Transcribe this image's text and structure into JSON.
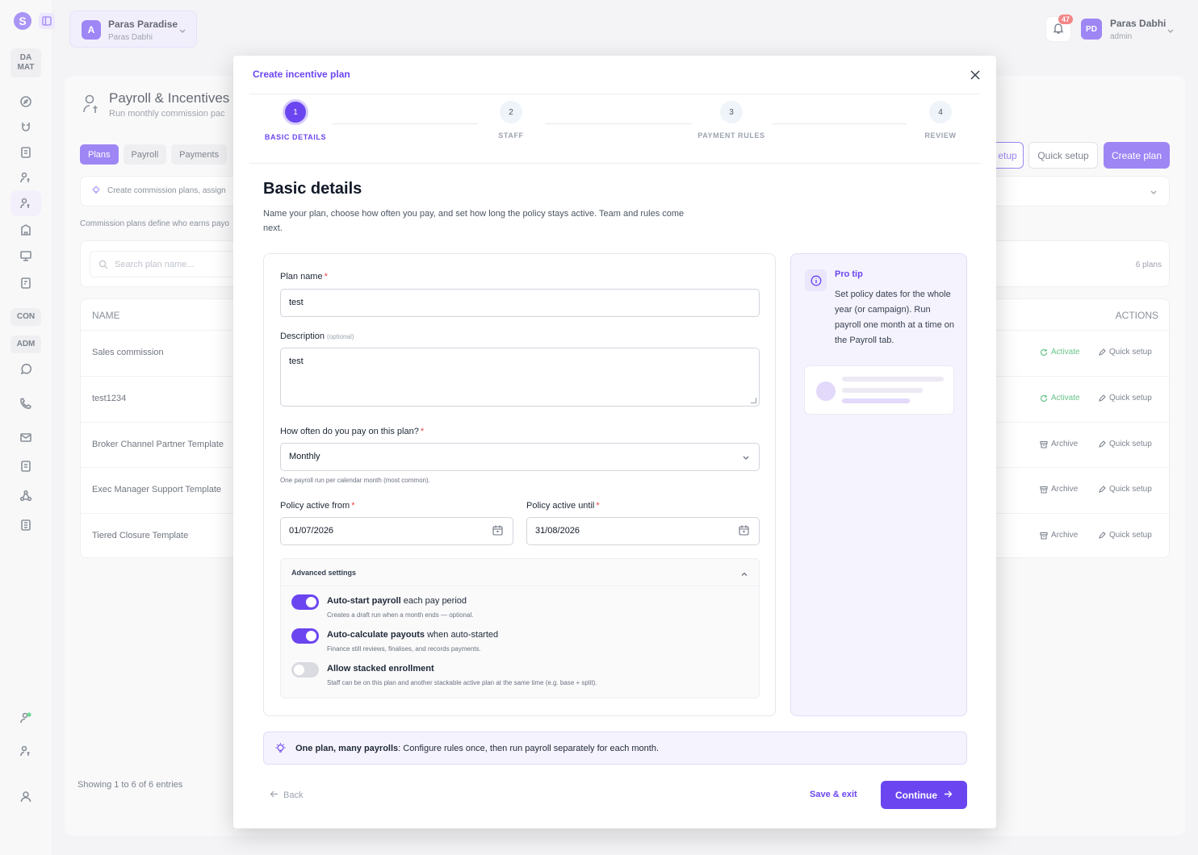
{
  "app": {
    "logo_letter": "S",
    "sidebar_tags": [
      "DA\nMAT",
      "CON",
      "ADM"
    ]
  },
  "org": {
    "avatar": "A",
    "name": "Paras Paradise",
    "sub": "Paras Dabhi"
  },
  "user": {
    "initials": "PD",
    "name": "Paras Dabhi",
    "role": "admin",
    "notifications": "47"
  },
  "page": {
    "title": "Payroll & Incentives",
    "subtitle": "Run monthly commission pac",
    "tabs": [
      "Plans",
      "Payroll",
      "Payments"
    ],
    "hint": "Create commission plans, assign s",
    "description": "Commission plans define who earns payo",
    "search_placeholder": "Search plan name...",
    "plan_count": "6 plans",
    "buttons": {
      "setup": "etup",
      "quick_setup": "Quick setup",
      "create_plan": "Create plan"
    },
    "table": {
      "col_name": "NAME",
      "col_actions": "ACTIONS",
      "rows": [
        {
          "name": "Sales commission",
          "action1": "Activate",
          "action2": "Quick setup"
        },
        {
          "name": "test1234",
          "action1": "Activate",
          "action2": "Quick setup"
        },
        {
          "name": "Broker Channel Partner Template",
          "action1": "Archive",
          "action2": "Quick setup"
        },
        {
          "name": "Exec Manager Support Template",
          "action1": "Archive",
          "action2": "Quick setup"
        },
        {
          "name": "Tiered Closure Template",
          "action1": "Archive",
          "action2": "Quick setup"
        }
      ]
    },
    "showing": "Showing 1 to 6 of 6 entries"
  },
  "modal": {
    "title": "Create incentive plan",
    "steps": [
      {
        "num": "1",
        "label": "BASIC DETAILS"
      },
      {
        "num": "2",
        "label": "STAFF"
      },
      {
        "num": "3",
        "label": "PAYMENT RULES"
      },
      {
        "num": "4",
        "label": "REVIEW"
      }
    ],
    "heading": "Basic details",
    "intro": "Name your plan, choose how often you pay, and set how long the policy stays active. Team and rules come next.",
    "form": {
      "plan_name_label": "Plan name",
      "plan_name_value": "test",
      "description_label": "Description",
      "optional": "(optional)",
      "description_value": "test",
      "frequency_label": "How often do you pay on this plan?",
      "frequency_value": "Monthly",
      "frequency_help": "One payroll run per calendar month (most common).",
      "active_from_label": "Policy active from",
      "active_from_value": "01/07/2026",
      "active_until_label": "Policy active until",
      "active_until_value": "31/08/2026",
      "required_mark": "*"
    },
    "advanced": {
      "title": "Advanced settings",
      "toggles": [
        {
          "bold": "Auto-start payroll",
          "rest": " each pay period",
          "sub": "Creates a draft run when a month ends — optional.",
          "on": true
        },
        {
          "bold": "Auto-calculate payouts",
          "rest": " when auto-started",
          "sub": "Finance still reviews, finalises, and records payments.",
          "on": true
        },
        {
          "bold": "Allow stacked enrollment",
          "rest": "",
          "sub": "Staff can be on this plan and another stackable active plan at the same time (e.g. base + split).",
          "on": false
        }
      ]
    },
    "tip": {
      "title": "Pro tip",
      "text": "Set policy dates for the whole year (or campaign). Run payroll one month at a time on the Payroll tab."
    },
    "banner": {
      "bold": "One plan, many payrolls",
      "rest": ": Configure rules once, then run payroll separately for each month."
    },
    "footer": {
      "back": "Back",
      "save_exit": "Save & exit",
      "continue": "Continue"
    }
  },
  "colors": {
    "accent": "#6b46f0",
    "danger": "#ef4444",
    "success": "#16a34a"
  }
}
